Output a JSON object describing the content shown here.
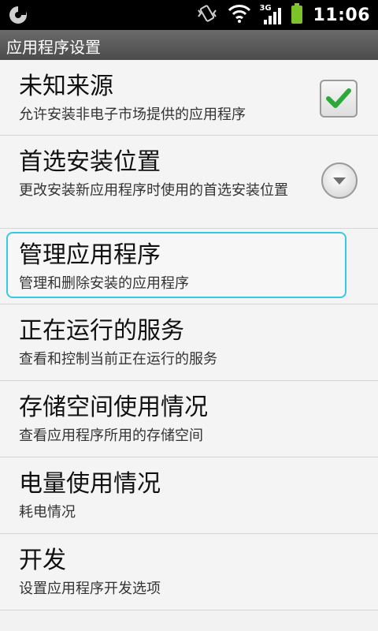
{
  "status_bar": {
    "time": "11:06",
    "icons": [
      "sd-card-icon",
      "vibrate-icon",
      "wifi-icon",
      "3g-signal-icon",
      "battery-icon"
    ],
    "network_label": "3G"
  },
  "header": {
    "title": "应用程序设置"
  },
  "settings": {
    "items": [
      {
        "title": "未知来源",
        "summary": "允许安装非电子市场提供的应用程序",
        "control": "checkbox",
        "checked": true
      },
      {
        "title": "首选安装位置",
        "summary": "更改安装新应用程序时使用的首选安装位置",
        "control": "dropdown"
      },
      {
        "title": "管理应用程序",
        "summary": "管理和删除安装的应用程序",
        "focused": true
      },
      {
        "title": "正在运行的服务",
        "summary": "查看和控制当前正在运行的服务"
      },
      {
        "title": "存储空间使用情况",
        "summary": "查看应用程序所用的存储空间"
      },
      {
        "title": "电量使用情况",
        "summary": "耗电情况"
      },
      {
        "title": "开发",
        "summary": "设置应用程序开发选项"
      }
    ]
  },
  "colors": {
    "focus": "#39c7e6",
    "check": "#2fa83a",
    "status_bar": "#000000",
    "title_bar": "#595959"
  }
}
